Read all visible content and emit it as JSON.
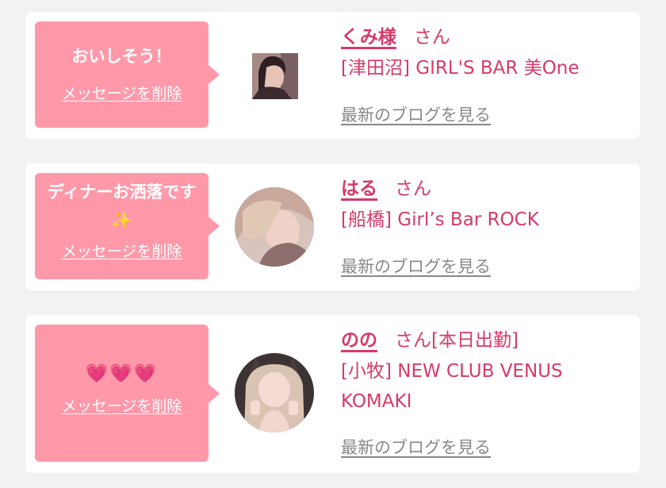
{
  "colors": {
    "accent": "#d63a6a",
    "bubble": "#ff99aa",
    "link_gray": "#888888"
  },
  "cards": [
    {
      "message": "おいしそう！",
      "delete_label": "メッセージを削除",
      "name": "くみ様",
      "suffix": "さん",
      "shop_line1": "[津田沼] GIRL'S BAR 美One",
      "shop_line2": "",
      "blog_label": "最新のブログを見る"
    },
    {
      "message": "ディナーお洒落です✨",
      "delete_label": "メッセージを削除",
      "name": "はる",
      "suffix": "さん",
      "shop_line1": "[船橋] Girl’s Bar ROCK",
      "shop_line2": "",
      "blog_label": "最新のブログを見る"
    },
    {
      "message": "💗💗💗",
      "delete_label": "メッセージを削除",
      "name": "のの",
      "suffix": "さん[本日出勤]",
      "shop_line1": "[小牧] NEW CLUB VENUS",
      "shop_line2": "KOMAKI",
      "blog_label": "最新のブログを見る"
    }
  ]
}
